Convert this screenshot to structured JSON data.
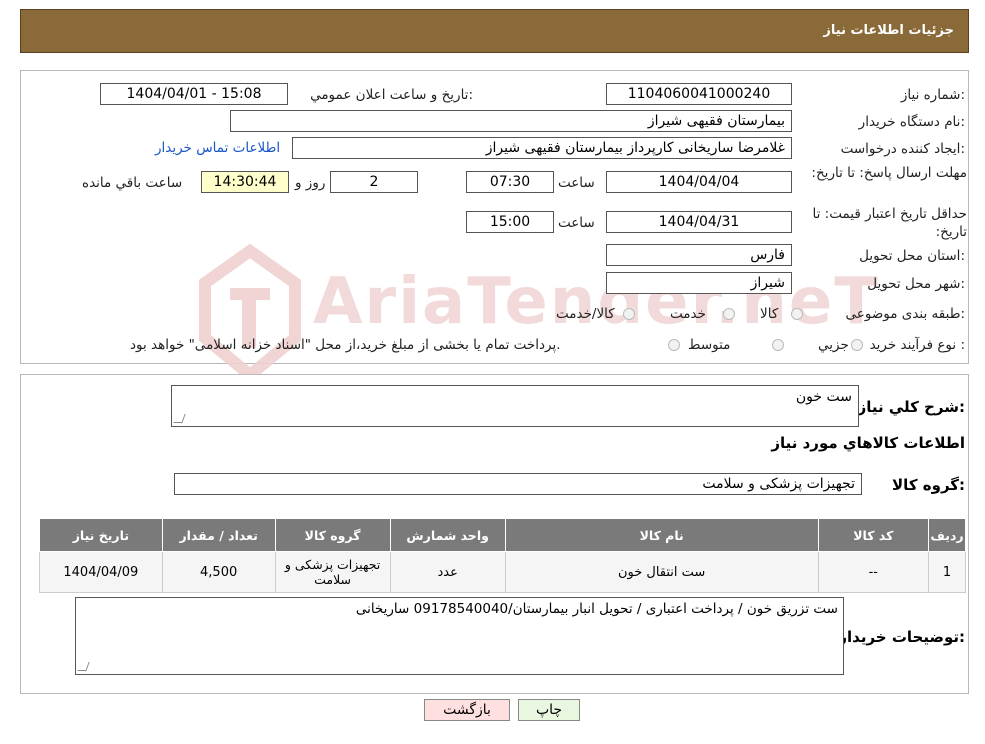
{
  "header": {
    "title": "جزئیات اطلاعات نیاز"
  },
  "watermark": {
    "text": "AriaTender.neT"
  },
  "form": {
    "need_number_label": "شماره نیاز:",
    "need_number": "1104060041000240",
    "announce_label": "تاریخ و ساعت اعلان عمومي:",
    "announce_value": "1404/04/01 - 15:08",
    "buyer_org_label": "نام دستگاه خریدار:",
    "buyer_org": "بیمارستان فقیهی شیراز",
    "requester_label": "ایجاد کننده درخواست:",
    "requester": "غلامرضا ساریخانی کارپرداز بیمارستان فقیهی شیراز",
    "contact_link": "اطلاعات تماس خریدار",
    "reply_deadline_label": "مهلت ارسال پاسخ: تا تاریخ:",
    "reply_date": "1404/04/04",
    "time_label": "ساعت",
    "reply_time": "07:30",
    "days_value": "2",
    "days_label": "روز و",
    "remaining_time": "14:30:44",
    "remaining_label": "ساعت باقي مانده",
    "price_validity_label": "حداقل تاریخ اعتبار قیمت: تا تاریخ:",
    "price_date": "1404/04/31",
    "price_time": "15:00",
    "province_label": "استان محل تحویل:",
    "province": "فارس",
    "city_label": "شهر محل تحویل:",
    "city": "شیراز",
    "category_label": "طبقه بندی موضوعی:",
    "category_options": [
      "کالا",
      "خدمت",
      "کالا/خدمت"
    ],
    "process_label": "نوع فرآیند خرید :",
    "process_options": [
      "جزیي",
      "متوسط"
    ],
    "process_note": "پرداخت تمام یا بخشی از مبلغ خرید،از محل \"اسناد خزانه اسلامی\" خواهد بود."
  },
  "summary": {
    "label": "شرح كلي نياز:",
    "value": "ست خون",
    "items_title": "اطلاعات کالاهاي مورد نياز",
    "group_label": "گروه کالا:",
    "group_value": "تجهیزات پزشکی و سلامت"
  },
  "table": {
    "headers": [
      "ردیف",
      "کد کالا",
      "نام کالا",
      "واحد شمارش",
      "گروه کالا",
      "تعداد / مقدار",
      "تاریخ نیاز"
    ],
    "rows": [
      [
        "1",
        "--",
        "ست انتقال خون",
        "عدد",
        "تجهیزات پزشکی و سلامت",
        "4,500",
        "1404/04/09"
      ]
    ]
  },
  "buyer_notes": {
    "label": "توضیحات خریدار:",
    "value": "ست تزریق خون / پرداخت اعتباری / تحویل انبار بیمارستان/09178540040 ساریخانی"
  },
  "buttons": {
    "print": "چاپ",
    "back": "بازگشت"
  },
  "colors": {
    "header_bg": "#8b6a3a",
    "table_header_bg": "#7a7a7a",
    "back_btn_bg": "#ffe0e0",
    "print_btn_bg": "#e9f7e0",
    "remaining_bg": "#ffffcc"
  }
}
